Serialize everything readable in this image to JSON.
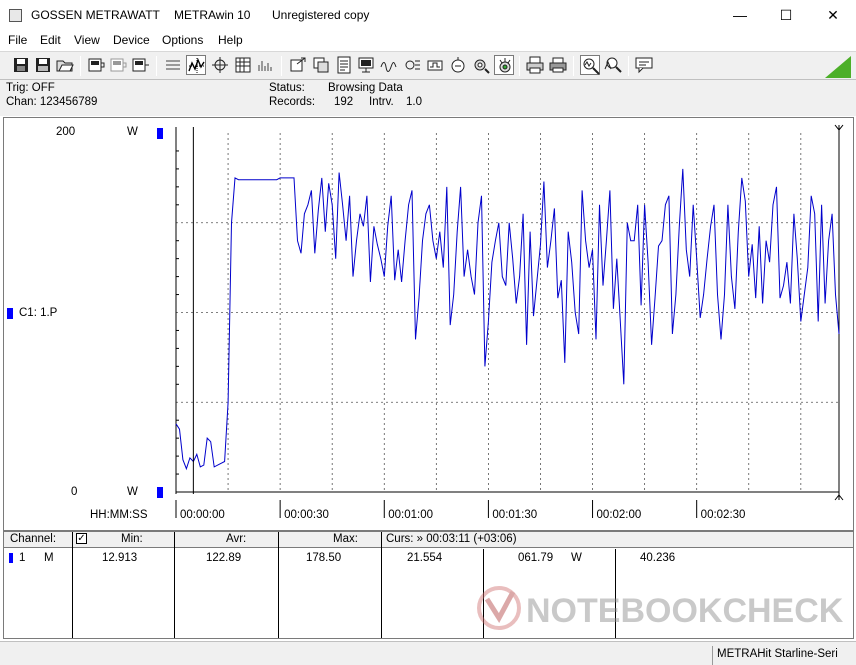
{
  "window": {
    "title_vendor": "GOSSEN METRAWATT",
    "title_app": "METRAwin 10",
    "title_license": "Unregistered copy",
    "minimize_glyph": "—",
    "maximize_glyph": "☐",
    "close_glyph": "✕"
  },
  "menu": [
    "File",
    "Edit",
    "View",
    "Device",
    "Options",
    "Help"
  ],
  "status": {
    "trig": "Trig: OFF",
    "chan": "Chan:  123456789",
    "status_label": "Status:",
    "status_value": "Browsing Data",
    "records_label": "Records:",
    "records_value": "192",
    "intrv_label": "Intrv.",
    "intrv_value": "1.0"
  },
  "chart_data": {
    "type": "line",
    "ylim": [
      0,
      200
    ],
    "y_top_label": "200",
    "y_bottom_label": "0",
    "y_unit": "W",
    "channel_label": "C1: 1.P",
    "x_axis_label": "HH:MM:SS",
    "xlim_seconds": [
      0,
      191
    ],
    "x_tick_labels": [
      "00:00:00",
      "00:00:30",
      "00:01:00",
      "00:01:30",
      "00:02:00",
      "00:02:30"
    ],
    "line_color": "#0000cc",
    "grid": true,
    "series": [
      {
        "values": [
          38,
          35,
          18,
          13,
          19,
          17,
          21,
          14,
          15,
          30,
          28,
          14,
          15,
          16,
          17,
          50,
          150,
          175,
          174,
          174,
          174,
          174,
          174,
          174,
          174,
          174,
          174,
          174,
          174,
          174,
          175,
          175,
          175,
          175,
          175,
          140,
          133,
          155,
          160,
          168,
          133,
          157,
          175,
          145,
          172,
          160,
          130,
          178,
          160,
          140,
          165,
          120,
          140,
          155,
          148,
          165,
          117,
          148,
          138,
          130,
          120,
          148,
          165,
          118,
          135,
          117,
          140,
          160,
          168,
          85,
          108,
          140,
          155,
          160,
          140,
          130,
          145,
          125,
          170,
          93,
          110,
          145,
          170,
          120,
          135,
          120,
          110,
          150,
          165,
          70,
          95,
          128,
          140,
          150,
          120,
          115,
          150,
          130,
          105,
          120,
          155,
          82,
          145,
          98,
          118,
          138,
          173,
          125,
          140,
          158,
          108,
          118,
          72,
          145,
          128,
          100,
          88,
          168,
          140,
          125,
          135,
          85,
          160,
          115,
          140,
          168,
          102,
          130,
          95,
          60,
          150,
          140,
          140,
          160,
          104,
          160,
          128,
          82,
          108,
          137,
          140,
          160,
          165,
          88,
          110,
          148,
          180,
          135,
          120,
          160,
          130,
          97,
          110,
          130,
          148,
          160,
          110,
          85,
          110,
          160,
          120,
          102,
          145,
          175,
          162,
          120,
          138,
          108,
          148,
          105,
          140,
          128,
          160,
          170,
          108,
          115,
          128,
          105,
          155,
          130,
          95,
          110,
          125,
          165,
          155,
          95,
          160,
          105,
          140,
          155,
          110,
          88
        ]
      }
    ]
  },
  "table": {
    "headers": {
      "channel": "Channel:",
      "min": "Min:",
      "avr": "Avr:",
      "max": "Max:",
      "curs": "Curs:  » 00:03:11 (+03:06)"
    },
    "row": {
      "chan": "1",
      "mode": "M",
      "min": "12.913",
      "avr": "122.89",
      "max": "178.50",
      "curs1": "21.554",
      "curs2": "061.79",
      "unit": "W",
      "curs3": "40.236"
    }
  },
  "footer": {
    "brand": "METRAHit Starline-Seri"
  },
  "watermark": {
    "text": "NOTEBOOKCHECK"
  },
  "icons": [
    "open-icon",
    "save-icon",
    "print-icon",
    "device-icon",
    "table-icon",
    "zoom-icon",
    "cursor-icon",
    "printer-icon",
    "settings-icon"
  ],
  "colors": {
    "plot_line": "#0000cc",
    "marker_blue": "#0000ff",
    "accent_green": "#4caf28",
    "chrome_gray": "#f0f0f0"
  }
}
